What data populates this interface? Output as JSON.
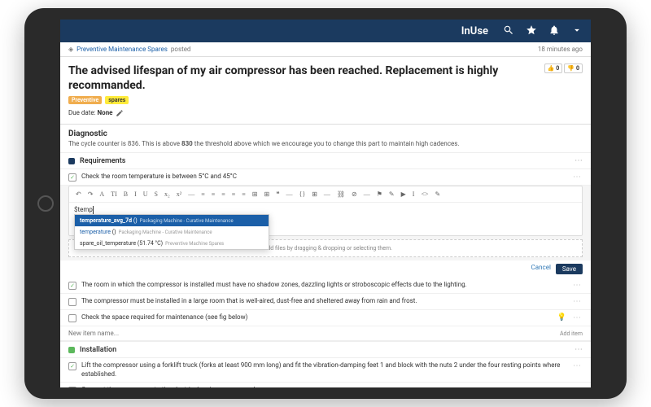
{
  "header": {
    "brand": "InUse"
  },
  "breadcrumb": {
    "category": "Preventive Maintenance Spares",
    "status": "posted",
    "timestamp": "18 minutes ago"
  },
  "post": {
    "title": "The advised lifespan of my air compressor has been reached. Replacement is highly recommanded.",
    "tag_preventive": "Preventive",
    "tag_spares": "spares",
    "reaction_up": "0",
    "reaction_down": "0",
    "due_label": "Due date:",
    "due_value": "None"
  },
  "diagnostic": {
    "heading": "Diagnostic",
    "text_pre": "The cycle counter is 836. This is above ",
    "threshold": "830",
    "text_post": " the threshold above which we encourage you to change this part to maintain high cadences."
  },
  "requirements": {
    "heading": "Requirements",
    "item1": "Check the room temperature is between 5°C and 45°C",
    "editor_text": "$temp",
    "ac1_var": "temperature_avg_7d",
    "ac1_val": "()",
    "ac1_src": "Packaging Machine - Curative Maintenance",
    "ac2_var": "temperature",
    "ac2_val": "()",
    "ac2_src": "Packaging Machine - Curative Maintenance",
    "ac3_var": "spare_oil_temperature",
    "ac3_val": "(51.74 °C)",
    "ac3_src": "Preventive Machine Spares",
    "dropzone": "+ Add files by dragging & dropping or selecting them.",
    "cancel": "Cancel",
    "save": "Save",
    "item2": "The room in which the compressor is installed must have no shadow zones, dazzling lights or stroboscopic effects due to the lighting.",
    "item3": "The compressor must be installed in a large room that is well-aired, dust-free and sheltered away from rain and frost.",
    "item4": "Check the space required for maintenance (see fig below)",
    "new_placeholder": "New item name...",
    "add_label": "Add item"
  },
  "installation": {
    "heading": "Installation",
    "item1": "Lift the compressor using a forklift truck (forks at least 900 mm long) and fit the vibration-damping feet 1 and block with the nuts 2 under the four resting points where established.",
    "item2": "Connect the compressor to the electrical mains power supply"
  },
  "toolbar": {
    "items": [
      "↶",
      "↷",
      "A",
      "TI",
      "B",
      "I",
      "U",
      "S",
      "x₂",
      "x²",
      "—",
      "≡",
      "≡",
      "≡",
      "≡",
      "≡",
      "⊞",
      "⊞",
      "❝",
      "—",
      "{}",
      "⊞",
      "—",
      "⛓",
      "⊘",
      "—",
      "⚑",
      "✎",
      "▶",
      "I",
      "<>",
      "✎"
    ]
  }
}
